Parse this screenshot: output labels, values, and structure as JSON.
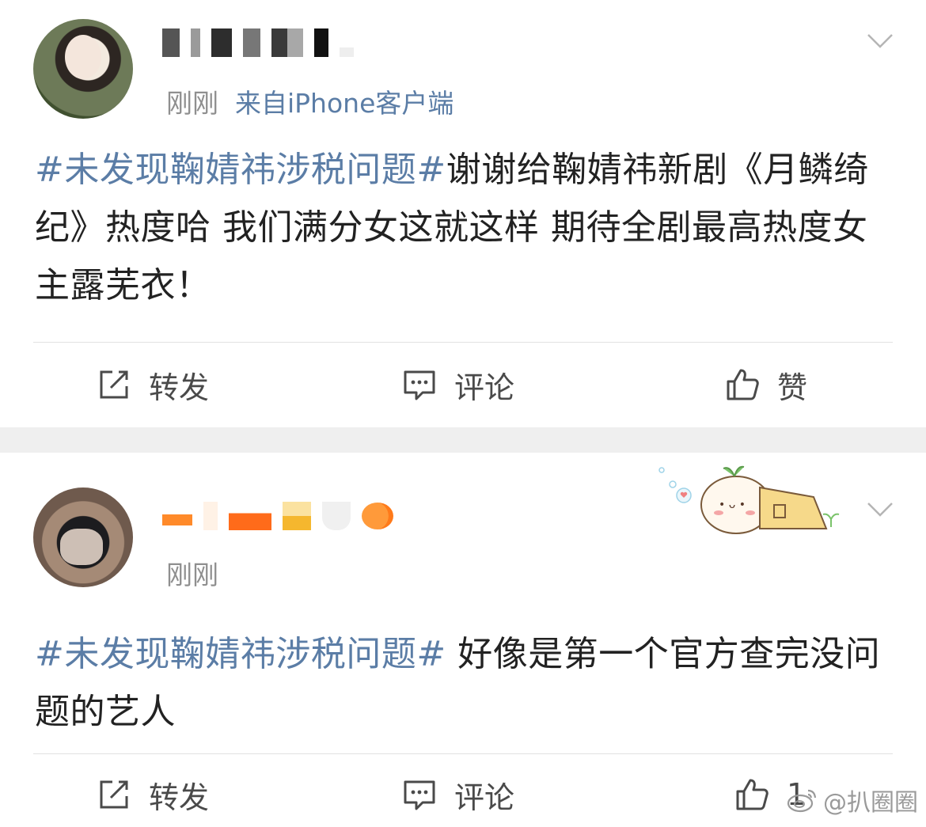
{
  "posts": [
    {
      "time": "刚刚",
      "source": "来自iPhone客户端",
      "hashtag": "#未发现鞠婧祎涉税问题#",
      "text": "谢谢给鞠婧祎新剧《月鳞绮纪》热度哈 我们满分女这就这样 期待全剧最高热度女主露芜衣！",
      "actions": {
        "repost": "转发",
        "comment": "评论",
        "like": "赞"
      }
    },
    {
      "time": "刚刚",
      "hashtag": "#未发现鞠婧祎涉税问题#",
      "text": " 好像是第一个官方查完没问题的艺人",
      "actions": {
        "repost": "转发",
        "comment": "评论",
        "like_count": "1"
      }
    }
  ],
  "watermark": "@扒圈圈",
  "icons": [
    "avatar",
    "chevron-down-icon",
    "repost-icon",
    "comment-icon",
    "like-icon",
    "sticker",
    "weibo-logo-icon"
  ],
  "colors": {
    "link": "#5b7da6",
    "meta": "#8f8f8f",
    "separator": "#efefef"
  }
}
